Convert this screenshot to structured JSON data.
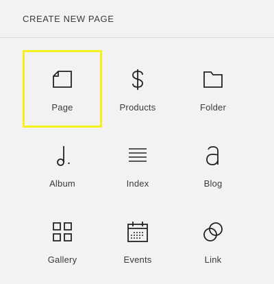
{
  "header": {
    "title": "CREATE NEW PAGE"
  },
  "colors": {
    "background": "#f2f2f2",
    "selection": "#f5f01a",
    "text": "#3a3a3a",
    "icon": "#222222"
  },
  "items": [
    {
      "label": "Page",
      "icon": "page-icon",
      "selected": true
    },
    {
      "label": "Products",
      "icon": "dollar-icon",
      "selected": false
    },
    {
      "label": "Folder",
      "icon": "folder-icon",
      "selected": false
    },
    {
      "label": "Album",
      "icon": "music-note-icon",
      "selected": false
    },
    {
      "label": "Index",
      "icon": "index-lines-icon",
      "selected": false
    },
    {
      "label": "Blog",
      "icon": "letter-a-icon",
      "selected": false
    },
    {
      "label": "Gallery",
      "icon": "grid-icon",
      "selected": false
    },
    {
      "label": "Events",
      "icon": "calendar-icon",
      "selected": false
    },
    {
      "label": "Link",
      "icon": "link-circles-icon",
      "selected": false
    }
  ]
}
